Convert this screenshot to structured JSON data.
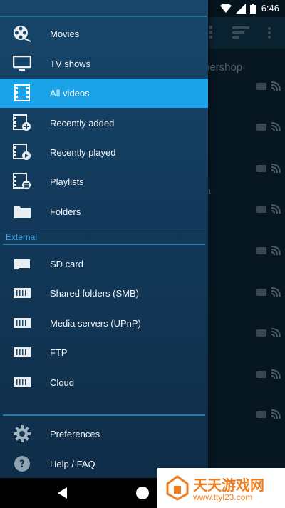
{
  "status_bar": {
    "time": "6:46"
  },
  "background": {
    "title_fragment": "bershop",
    "letter": "a"
  },
  "drawer": {
    "library_items": [
      {
        "label": "Movies",
        "icon": "film-reel-icon"
      },
      {
        "label": "TV shows",
        "icon": "tv-icon"
      },
      {
        "label": "All videos",
        "icon": "film-strip-icon",
        "selected": true
      },
      {
        "label": "Recently added",
        "icon": "film-strip-plus-icon"
      },
      {
        "label": "Recently played",
        "icon": "film-strip-play-icon"
      },
      {
        "label": "Playlists",
        "icon": "film-strip-list-icon"
      },
      {
        "label": "Folders",
        "icon": "folder-icon"
      }
    ],
    "external_header": "External",
    "external_items": [
      {
        "label": "SD card",
        "icon": "sd-card-icon"
      },
      {
        "label": "Shared folders (SMB)",
        "icon": "network-drive-icon"
      },
      {
        "label": "Media servers (UPnP)",
        "icon": "network-drive-icon"
      },
      {
        "label": "FTP",
        "icon": "network-drive-icon"
      },
      {
        "label": "Cloud",
        "icon": "network-drive-icon"
      }
    ],
    "footer_items": [
      {
        "label": "Preferences",
        "icon": "gear-icon"
      },
      {
        "label": "Help / FAQ",
        "icon": "help-icon"
      }
    ]
  },
  "watermark": {
    "title": "天天游戏网",
    "url": "www.ttyl23.com"
  },
  "colors": {
    "accent": "#1aa3e8",
    "drawer": "#13395a",
    "section_header": "#37a4e6"
  }
}
